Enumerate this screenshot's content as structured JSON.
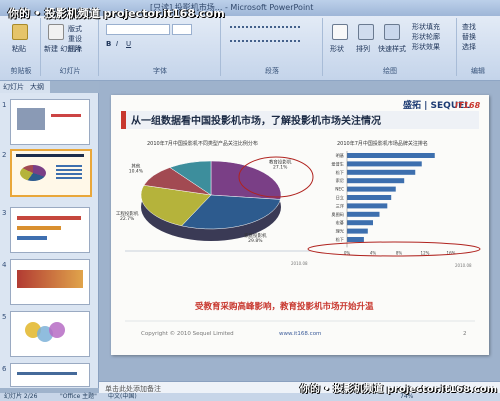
{
  "window": {
    "title": "[只读] 投影机市场... - Microsoft PowerPoint"
  },
  "watermark": {
    "top": "你的 • 投影机频道  projector.it168.com",
    "bottom": "你的 • 投影机频道  projector.it168.com"
  },
  "ribbon": {
    "paste": "粘贴",
    "new_slide": "新建\n幻灯片",
    "layout": "版式",
    "reset": "重设",
    "delete": "删除",
    "groups": [
      "剪贴板",
      "幻灯片",
      "字体",
      "段落",
      "绘图",
      "编辑"
    ],
    "shapes": "形状",
    "arrange": "排列",
    "quick_styles": "快速样式",
    "shape_fill": "形状填充",
    "shape_outline": "形状轮廓",
    "shape_effects": "形状效果",
    "find": "查找",
    "replace": "替换",
    "select": "选择"
  },
  "left_tabs": {
    "slides": "幻灯片",
    "outline": "大纲"
  },
  "thumbnails": [
    {
      "num": "1"
    },
    {
      "num": "2"
    },
    {
      "num": "3"
    },
    {
      "num": "4"
    },
    {
      "num": "5"
    },
    {
      "num": "6"
    }
  ],
  "slide": {
    "logo_text": "盛拓 | SEQUEL",
    "logo_tag": "IT168",
    "title": "从一组数据看中国投影机市场，了解投影机市场关注情况",
    "pie_caption": "2010年7月中国投影机不同类型产品关注比例分布",
    "bar_caption": "2010年7月中国投影机市场品牌关注排名",
    "conclusion": "受教育采购高峰影响，教育投影机市场开始升温",
    "copyright": "Copyright © 2010  Sequel Limited",
    "url": "www.it168.com",
    "page": "2",
    "source_left": "2010.08",
    "source_right": "2010.08"
  },
  "chart_data": [
    {
      "type": "pie",
      "title": "2010年7月中国投影机不同类型产品关注比例分布",
      "slices": [
        {
          "name": "教育投影机",
          "value": 27.1
        },
        {
          "name": "家庭投影机",
          "value": 29.8
        },
        {
          "name": "工程投影机",
          "value": 22.7
        },
        {
          "name": "其他",
          "value": 10.4
        }
      ],
      "colors": [
        "#7a3f86",
        "#2d5b8e",
        "#b5b33b",
        "#a24a52",
        "#3d8e9c",
        "#7f9fcf"
      ]
    },
    {
      "type": "bar",
      "title": "2010年7月中国投影机市场品牌关注排名",
      "categories": [
        "明基",
        "爱普生",
        "松下",
        "索尼",
        "NEC",
        "日立",
        "三洋",
        "奥图码",
        "宏碁",
        "理光",
        "松下"
      ],
      "values": [
        13.5,
        11.5,
        10.5,
        8.8,
        7.5,
        6.8,
        6.2,
        5.0,
        4.0,
        3.2,
        2.6
      ],
      "xlim": [
        0,
        16
      ],
      "xticks": [
        "0%",
        "4%",
        "8%",
        "12%",
        "16%"
      ],
      "bar_color": "#3d6fae"
    }
  ],
  "notes": {
    "placeholder": "单击此处添加备注"
  },
  "status": {
    "slide_info": "幻灯片 2/26",
    "theme": "\"Office 主题\"",
    "language": "中文(中国)",
    "zoom": "74%"
  }
}
